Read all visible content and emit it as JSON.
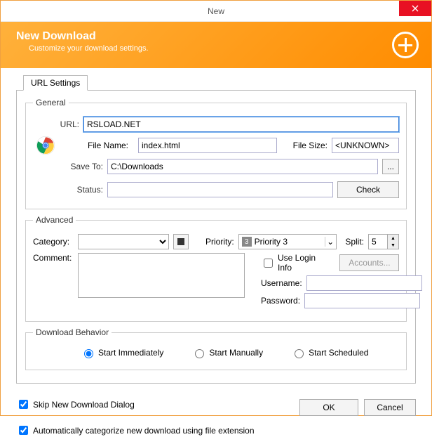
{
  "window": {
    "title": "New"
  },
  "banner": {
    "heading": "New Download",
    "sub": "Customize your download settings."
  },
  "tabs": {
    "url_settings": "URL Settings"
  },
  "general": {
    "legend": "General",
    "url_label": "URL:",
    "url_value": "RSLOAD.NET",
    "filename_label": "File Name:",
    "filename_value": "index.html",
    "filesize_label": "File Size:",
    "filesize_value": "<UNKNOWN>",
    "saveto_label": "Save To:",
    "saveto_value": "C:\\Downloads",
    "browse_label": "...",
    "status_label": "Status:",
    "status_value": "",
    "check_label": "Check"
  },
  "advanced": {
    "legend": "Advanced",
    "category_label": "Category:",
    "category_value": "",
    "priority_label": "Priority:",
    "priority_badge": "3",
    "priority_value": "Priority 3",
    "split_label": "Split:",
    "split_value": "5",
    "comment_label": "Comment:",
    "comment_value": "",
    "use_login_label": "Use Login Info",
    "use_login_checked": false,
    "accounts_label": "Accounts...",
    "username_label": "Username:",
    "username_value": "",
    "password_label": "Password:",
    "password_value": ""
  },
  "behavior": {
    "legend": "Download Behavior",
    "immediate": "Start Immediately",
    "manual": "Start Manually",
    "scheduled": "Start Scheduled",
    "selected": "immediate"
  },
  "footer": {
    "skip_label": "Skip New Download Dialog",
    "skip_checked": true,
    "autocat_label": "Automatically categorize new download using file extension",
    "autocat_checked": true,
    "ok": "OK",
    "cancel": "Cancel"
  }
}
